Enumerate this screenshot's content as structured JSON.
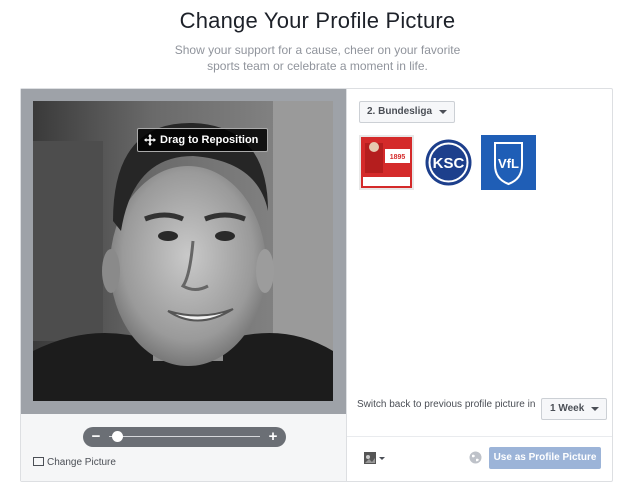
{
  "header": {
    "title": "Change Your Profile Picture",
    "subtitle_line1": "Show your support for a cause, cheer on your favorite",
    "subtitle_line2": "sports team or celebrate a moment in life."
  },
  "editor": {
    "drag_label": "Drag to Reposition",
    "zoom_minus": "−",
    "zoom_plus": "+",
    "zoom_level": 0.05,
    "change_picture_label": "Change Picture"
  },
  "frames": {
    "category_label": "2. Bundesliga",
    "thumbnails": [
      {
        "name": "frame-fortuna",
        "color": "#d42a2a",
        "badge_text": "1895"
      },
      {
        "name": "frame-ksc",
        "color": "#1d3f8c",
        "badge_text": "KSC"
      },
      {
        "name": "frame-vfl-bochum",
        "color": "#1f5eb6",
        "badge_text": "VfL"
      }
    ]
  },
  "schedule": {
    "switch_back_text": "Switch back to previous profile picture in",
    "duration_value": "1 Week"
  },
  "footer": {
    "use_button_label": "Use as Profile Picture",
    "colors": {
      "accent_disabled": "#9cb4d8"
    }
  }
}
